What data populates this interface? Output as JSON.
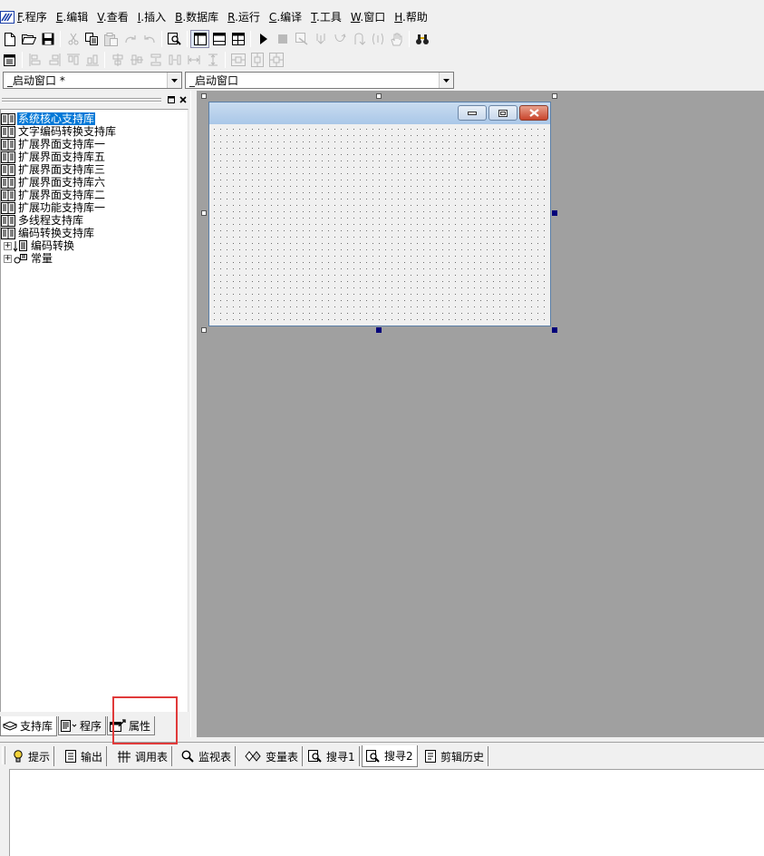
{
  "menu": [
    {
      "key": "F",
      "label": ".程序"
    },
    {
      "key": "E",
      "label": ".编辑"
    },
    {
      "key": "V",
      "label": ".查看"
    },
    {
      "key": "I",
      "label": ".插入"
    },
    {
      "key": "B",
      "label": ".数据库"
    },
    {
      "key": "R",
      "label": ".运行"
    },
    {
      "key": "C",
      "label": ".编译"
    },
    {
      "key": "T",
      "label": ".工具"
    },
    {
      "key": "W",
      "label": ".窗口"
    },
    {
      "key": "H",
      "label": ".帮助"
    }
  ],
  "combos": {
    "left": "_启动窗口 *",
    "right": "_启动窗口"
  },
  "tree": {
    "items": [
      {
        "label": "系统核心支持库",
        "selected": true
      },
      {
        "label": "文字编码转换支持库"
      },
      {
        "label": "扩展界面支持库一"
      },
      {
        "label": "扩展界面支持库五"
      },
      {
        "label": "扩展界面支持库三"
      },
      {
        "label": "扩展界面支持库六"
      },
      {
        "label": "扩展界面支持库二"
      },
      {
        "label": "扩展功能支持库一"
      },
      {
        "label": "多线程支持库"
      },
      {
        "label": "编码转换支持库"
      }
    ],
    "groups": [
      {
        "label": "编码转换",
        "expander": "+"
      },
      {
        "label": "常量",
        "expander": "+"
      }
    ]
  },
  "left_tabs": [
    {
      "label": "支持库",
      "icon": "library-icon",
      "active": true
    },
    {
      "label": "程序",
      "icon": "program-icon"
    },
    {
      "label": "属性",
      "icon": "properties-icon"
    }
  ],
  "output_tabs": [
    {
      "label": "提示",
      "icon": "hint-icon"
    },
    {
      "label": "输出",
      "icon": "output-icon"
    },
    {
      "label": "调用表",
      "icon": "call-table-icon"
    },
    {
      "label": "监视表",
      "icon": "watch-icon"
    },
    {
      "label": "变量表",
      "icon": "variables-icon"
    },
    {
      "label": "搜寻1",
      "icon": "search1-icon"
    },
    {
      "label": "搜寻2",
      "icon": "search2-icon",
      "active": true
    },
    {
      "label": "剪辑历史",
      "icon": "clip-history-icon"
    }
  ],
  "colors": {
    "selection": "#0078d7",
    "design_background": "#a0a0a0",
    "highlight_box": "#e03a3a"
  }
}
